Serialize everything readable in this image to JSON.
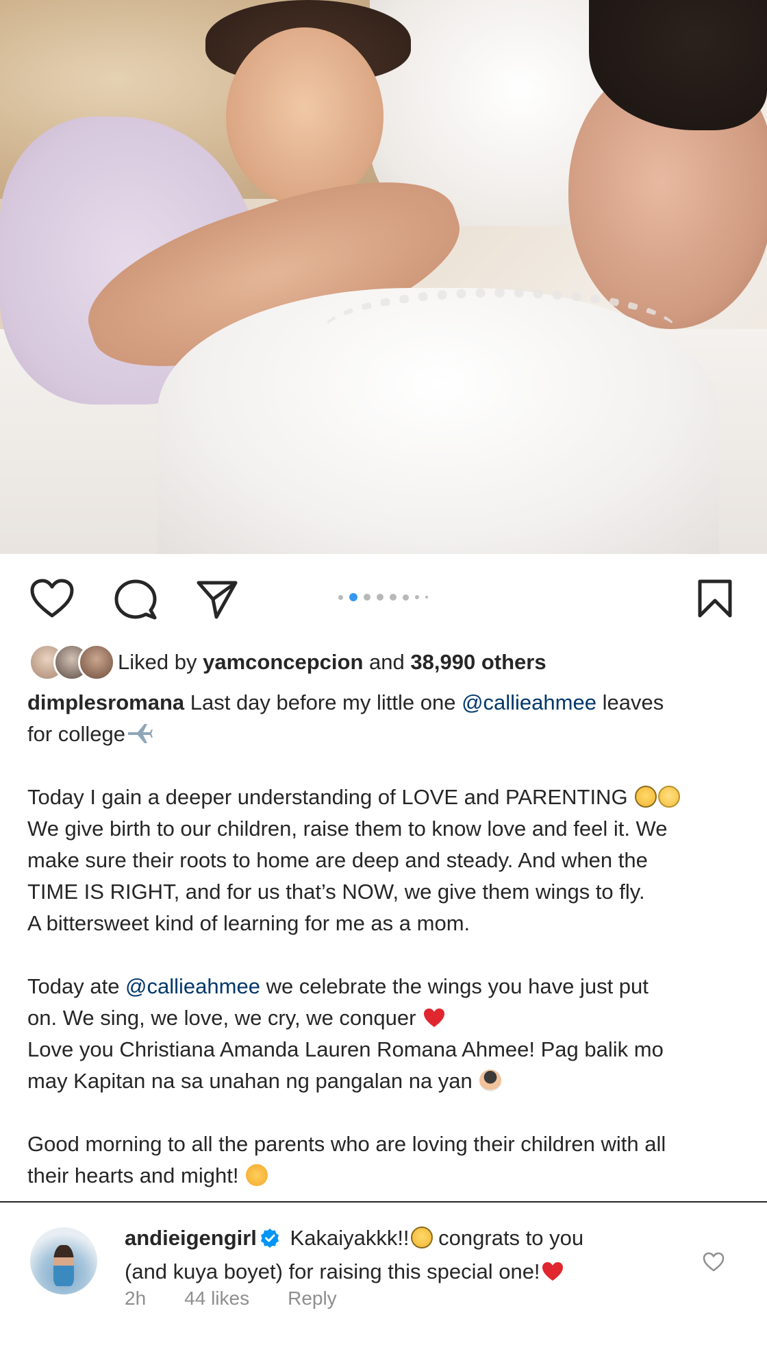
{
  "post": {
    "image_description_icon": "photo",
    "carousel": {
      "count": 8,
      "active_index": 1
    }
  },
  "icons": {
    "like": "heart-outline-icon",
    "comment": "comment-bubble-icon",
    "share": "send-paper-plane-icon",
    "save": "bookmark-outline-icon"
  },
  "likes": {
    "prefix": "Liked by",
    "user": "yamconcepcion",
    "connector": "and",
    "others": "38,990 others"
  },
  "caption": {
    "username": "dimplesromana",
    "line1_text": " Last day before my little one ",
    "mention1": "@callieahmee",
    "line1_end": " leaves",
    "line2": "for college",
    "p2_line1": "Today I gain a deeper understanding of LOVE and PARENTING ",
    "p2_line2": "We give birth to our children, raise them to know love and feel it. We",
    "p2_line3": "make sure their roots to home are deep and steady. And when the",
    "p2_line4": "TIME IS RIGHT, and for us that’s NOW, we give them wings to fly.",
    "p2_line5": "A bittersweet kind of learning for me as a mom.",
    "p3_line1_start": "Today ate ",
    "mention2": "@callieahmee",
    "p3_line1_end": " we celebrate the wings you have just put",
    "p3_line2": "on. We sing, we love, we cry, we conquer ",
    "p3_line3": "Love you Christiana Amanda Lauren Romana Ahmee! Pag balik mo",
    "p3_line4": "may Kapitan na sa unahan ng pangalan na yan ",
    "p4_line1": "Good morning to all the parents who are loving their children with all",
    "p4_line2": "their hearts and might! "
  },
  "comment": {
    "username": "andieigengirl",
    "text1": " Kakaiyakkk!!",
    "text1_end": " congrats to you",
    "text2": "(and kuya boyet) for raising this special one!",
    "time": "2h",
    "likes": "44 likes",
    "reply": "Reply"
  },
  "colors": {
    "text": "#262626",
    "mention": "#00376b",
    "muted": "#8e8e8e",
    "carousel_active": "#3797f0",
    "verified": "#0095f6",
    "heart": "#ed4956"
  }
}
